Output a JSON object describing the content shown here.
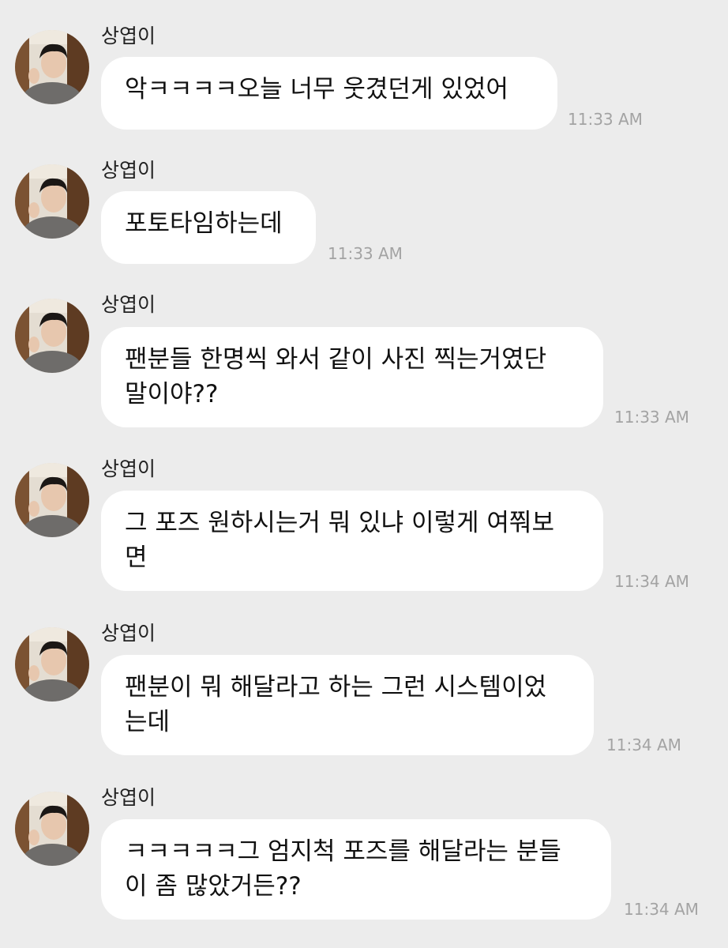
{
  "chat": {
    "messages": [
      {
        "sender": "상엽이",
        "text": "악ㅋㅋㅋㅋ오늘 너무 웃겼던게 있었어",
        "time": "11:33 AM"
      },
      {
        "sender": "상엽이",
        "text": "포토타임하는데",
        "time": "11:33 AM"
      },
      {
        "sender": "상엽이",
        "text": "팬분들 한명씩 와서 같이 사진 찍는거였단\n말이야??",
        "time": "11:33 AM"
      },
      {
        "sender": "상엽이",
        "text": "그 포즈 원하시는거 뭐 있냐 이렇게 여쭤보\n면",
        "time": "11:34 AM"
      },
      {
        "sender": "상엽이",
        "text": "팬분이 뭐 해달라고 하는 그런 시스템이었\n는데",
        "time": "11:34 AM"
      },
      {
        "sender": "상엽이",
        "text": "ㅋㅋㅋㅋㅋ그 엄지척 포즈를 해달라는 분들\n이 좀 많았거든??",
        "time": "11:34 AM"
      }
    ]
  }
}
